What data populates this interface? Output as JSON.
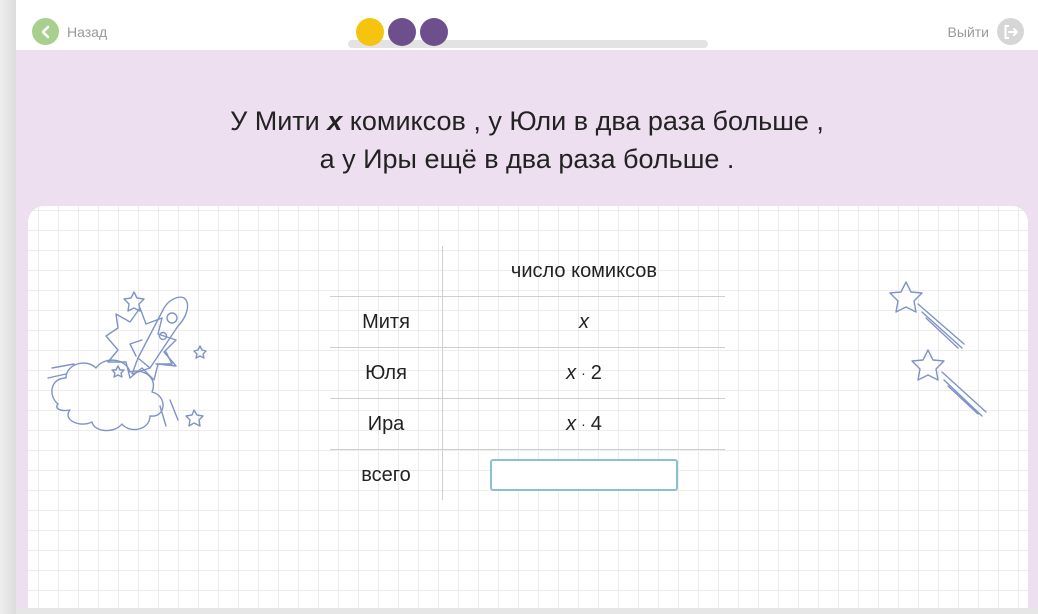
{
  "nav": {
    "back_label": "Назад",
    "exit_label": "Выйти",
    "progress_dots": [
      {
        "color": "#f6c40f"
      },
      {
        "color": "#6e4f8e"
      },
      {
        "color": "#6e4f8e"
      }
    ]
  },
  "problem": {
    "line1_a": "У Мити ",
    "line1_var": "x",
    "line1_b": " комиксов ,  у Юли в два раза больше ,",
    "line2": "а у Иры ещё в два раза больше ."
  },
  "table": {
    "header": "число комиксов",
    "rows": [
      {
        "name": "Митя",
        "var": "x",
        "factor": ""
      },
      {
        "name": "Юля",
        "var": "x",
        "factor": "2"
      },
      {
        "name": "Ира",
        "var": "x",
        "factor": "4"
      }
    ],
    "total_label": "всего",
    "total_value": "",
    "mul_sign": "·"
  },
  "colors": {
    "panel_bg": "#eddff0",
    "accent_green": "#a9cf8f",
    "input_border": "#88c2cf",
    "illustration": "#7f93c8"
  }
}
